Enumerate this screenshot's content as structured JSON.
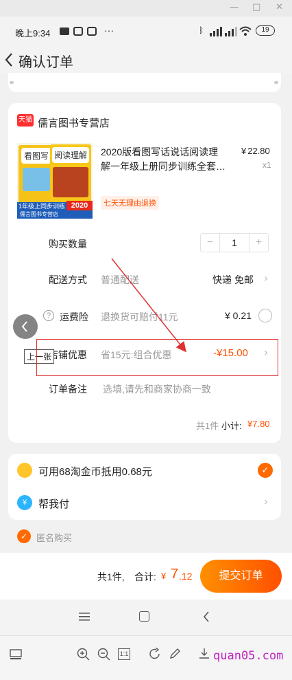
{
  "status_bar": {
    "time": "晚上9:34",
    "dots": "···",
    "battery": "19"
  },
  "header": {
    "title": "确认订单"
  },
  "shop": {
    "badge": "天猫",
    "name": "儒言图书专营店"
  },
  "product": {
    "title_line1": "2020版看图写话说话阅读理",
    "title_line2": "解一年级上册同步训练全套…",
    "price_symbol": "¥",
    "price": "22.80",
    "qty": "x1",
    "tag": "七天无理由退换",
    "cover_text_1": "看图写",
    "cover_text_2": "阅读理解",
    "cover_banner": "1年级上同步训练",
    "cover_year": "2020",
    "cover_store": "儒言图书专营店"
  },
  "rows": {
    "quantity_label": "购买数量",
    "quantity_value": "1",
    "minus": "−",
    "plus": "+",
    "delivery_label": "配送方式",
    "delivery_type": "普通配送",
    "delivery_value": "快递 免邮",
    "insurance_label": "运费险",
    "insurance_desc": "退换货可赔付11元",
    "insurance_value": "¥ 0.21",
    "discount_label": "店铺优惠",
    "discount_desc": "省15元:组合优惠",
    "discount_value": "-¥15.00",
    "note_label": "订单备注",
    "note_placeholder": "选填,请先和商家协商一致",
    "subtotal_count": "共1件",
    "subtotal_label": "小计:",
    "subtotal_value": "¥7.80"
  },
  "tooltip": "上一张",
  "options": {
    "coin_text": "可用68淘金币抵用0.68元",
    "pay_icon": "¥",
    "help_pay": "帮我付",
    "anonymous": "匿名购买"
  },
  "footer": {
    "count": "共1件,",
    "total_label": "合计:",
    "currency": "¥",
    "total_int": "7",
    "total_dec": ".12",
    "submit": "提交订单"
  },
  "watermark": "quan05.com",
  "colors": {
    "accent": "#ff5000",
    "button": "#ff6a00",
    "annotation": "#e03030"
  }
}
